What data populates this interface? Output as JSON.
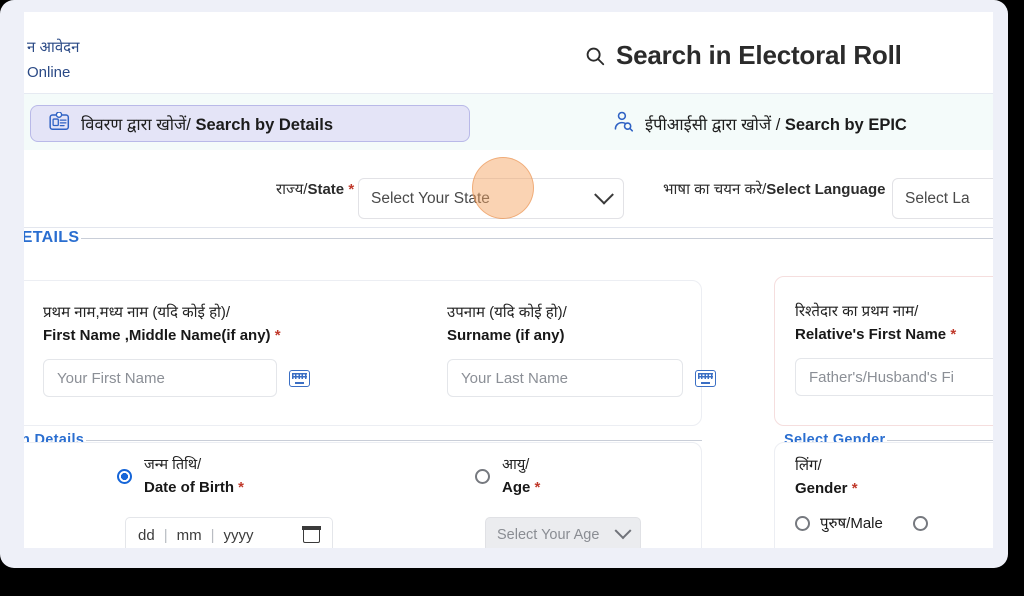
{
  "brand": {
    "line_hi": "न आवेदन",
    "line_en": "Online"
  },
  "header": {
    "title": "Search in Electoral Roll",
    "search_icon": "search-icon"
  },
  "tabs": [
    {
      "id": "details",
      "icon": "id-card-search-icon",
      "label_hi": "विवरण द्वारा खोजें/ ",
      "label_en": "Search by Details",
      "active": true
    },
    {
      "id": "epic",
      "icon": "person-search-icon",
      "label_hi": "ईपीआईसी द्वारा खोजें / ",
      "label_en": "Search by EPIC",
      "active": false
    }
  ],
  "selectors": {
    "state": {
      "label_hi": "राज्य/",
      "label_en": "State",
      "required": "*",
      "value": "Select Your State",
      "chevron": "chevron-down-icon"
    },
    "language": {
      "label_hi": "भाषा का चयन करे/",
      "label_en": "Select Language",
      "required": "",
      "value": "Select La"
    }
  },
  "sections": {
    "personal": "SONAL DETAILS",
    "birth": "Select Birth Details",
    "gender": "Select Gender"
  },
  "fields": {
    "first_name": {
      "label_hi": "प्रथम नाम,मध्य नाम (यदि कोई हो)/",
      "label_en": "First Name ,Middle Name(if any)",
      "required": "*",
      "placeholder": "Your First Name",
      "keyboard_icon": "keyboard-icon"
    },
    "surname": {
      "label_hi": "उपनाम (यदि कोई हो)/",
      "label_en": "Surname (if any)",
      "required": "",
      "placeholder": "Your Last Name",
      "keyboard_icon": "keyboard-icon"
    },
    "relative_first_name": {
      "label_hi": "रिश्तेदार का प्रथम नाम/",
      "label_en": "Relative's First Name",
      "required": "*",
      "placeholder": "Father's/Husband's Fi"
    }
  },
  "birth": {
    "dob": {
      "label_hi": "जन्म तिथि/",
      "label_en": "Date of Birth",
      "required": "*",
      "selected": true,
      "day": "dd",
      "month": "mm",
      "year": "yyyy",
      "separator": "|",
      "calendar_icon": "calendar-icon"
    },
    "age": {
      "label_hi": "आयु/",
      "label_en": "Age",
      "required": "*",
      "selected": false,
      "value": "Select Your Age",
      "disabled": true,
      "chevron": "chevron-down-icon"
    }
  },
  "gender": {
    "label_hi": "लिंग/",
    "label_en": "Gender",
    "required": "*",
    "options": [
      {
        "label": "पुरुष/Male",
        "selected": false
      },
      {
        "label": "",
        "selected": false
      }
    ]
  },
  "overlay": {
    "click_highlight": "click-highlight-circle",
    "color": "#f4a261"
  }
}
